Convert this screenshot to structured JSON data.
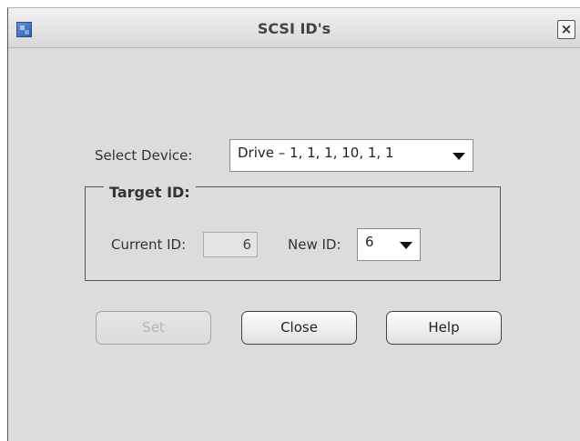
{
  "window": {
    "title": "SCSI ID's",
    "close_glyph": "×"
  },
  "device": {
    "label": "Select Device:",
    "selected": "Drive – 1, 1, 1, 10, 1, 1"
  },
  "target": {
    "group_title": "Target ID:",
    "current_label": "Current ID:",
    "current_value": "6",
    "new_label": "New ID:",
    "new_value": "6"
  },
  "buttons": {
    "set_label": "Set",
    "close_label": "Close",
    "help_label": "Help"
  },
  "icons": {
    "app": "app-window-icon",
    "close": "close-icon",
    "dropdown": "dropdown-arrow-icon"
  }
}
